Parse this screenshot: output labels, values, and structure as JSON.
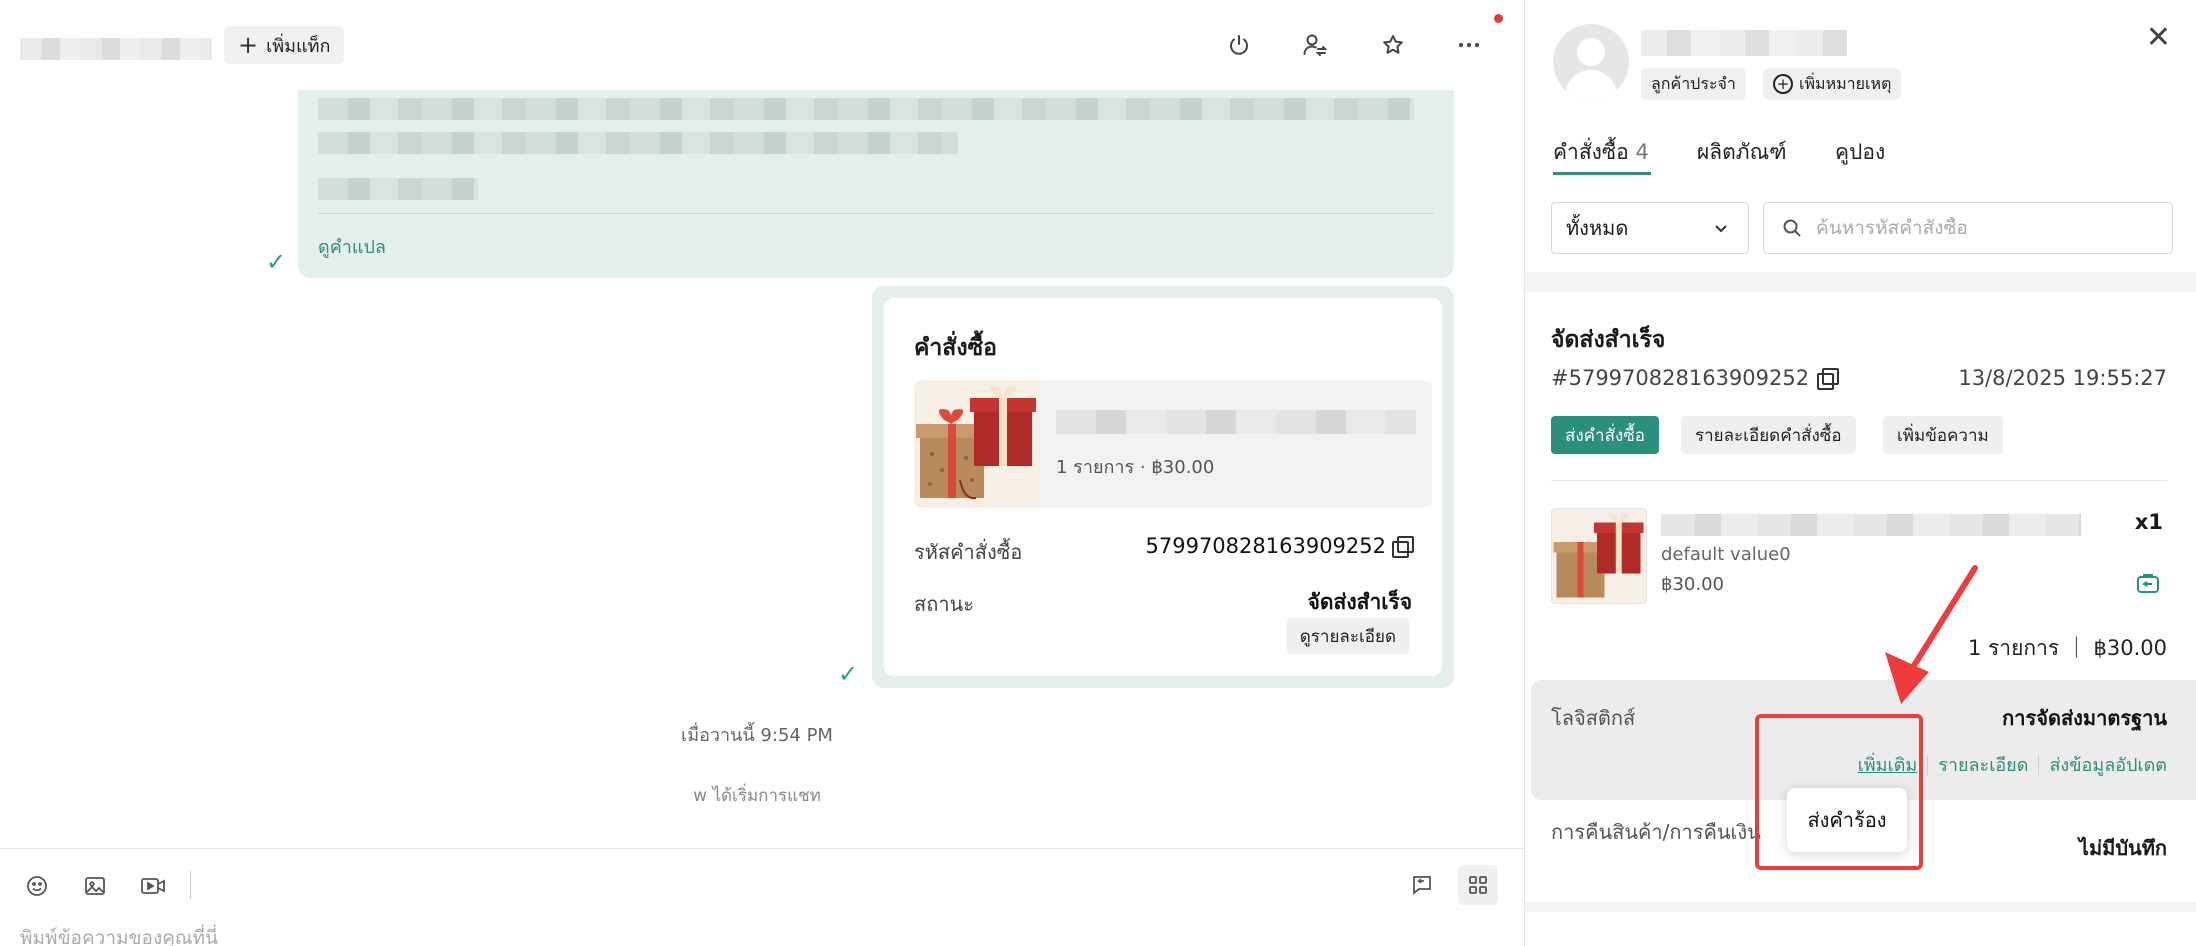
{
  "header": {
    "add_tag_label": "เพิ่มแท็ก",
    "icons": [
      "power-icon",
      "transfer-user-icon",
      "star-icon",
      "more-icon"
    ]
  },
  "messages": {
    "see_translation": "ดูคำแปล",
    "order_card": {
      "title": "คำสั่งซื้อ",
      "product_meta": "1 รายการ · ฿30.00",
      "order_id_label": "รหัสคำสั่งซื้อ",
      "order_id_value": "579970828163909252",
      "status_label": "สถานะ",
      "status_value": "จัดส่งสำเร็จ",
      "detail_button": "ดูรายละเอียด"
    },
    "timestamp": "เมื่อวานนี้ 9:54 PM",
    "system_notice": "w ได้เริ่มการแชท"
  },
  "composer": {
    "placeholder": "พิมพ์ข้อความของคุณที่นี่"
  },
  "customer": {
    "chip_regular": "ลูกค้าประจำ",
    "chip_add_note": "เพิ่มหมายเหตุ"
  },
  "tabs": [
    {
      "label": "คำสั่งซื้อ",
      "count": "4"
    },
    {
      "label": "ผลิตภัณฑ์"
    },
    {
      "label": "คูปอง"
    }
  ],
  "filter": {
    "selected": "ทั้งหมด",
    "search_placeholder": "ค้นหารหัสคำสั่งซื้อ"
  },
  "order_panel": {
    "status": "จัดส่งสำเร็จ",
    "order_id": "#579970828163909252",
    "date": "13/8/2025 19:55:27",
    "buttons": [
      "ส่งคำสั่งซื้อ",
      "รายละเอียดคำสั่งซื้อ",
      "เพิ่มข้อความ"
    ],
    "item_qty": "x1",
    "item_variant": "default value0",
    "item_price": "฿30.00",
    "total": "1 รายการ ｜ ฿30.00",
    "logistics_label": "โลจิสติกส์",
    "logistics_value": "การจัดส่งมาตรฐาน",
    "logistics_links": [
      "เพิ่มเติม",
      "รายละเอียด",
      "ส่งข้อมูลอัปเดต"
    ],
    "popup_item": "ส่งคำร้อง",
    "return_label": "การคืนสินค้า/การคืนเงิน",
    "return_value": "ไม่มีบันทึก"
  },
  "colors": {
    "accent": "#2b8f7d",
    "bubble": "#e4efed",
    "highlight": "#ee3b3b"
  }
}
